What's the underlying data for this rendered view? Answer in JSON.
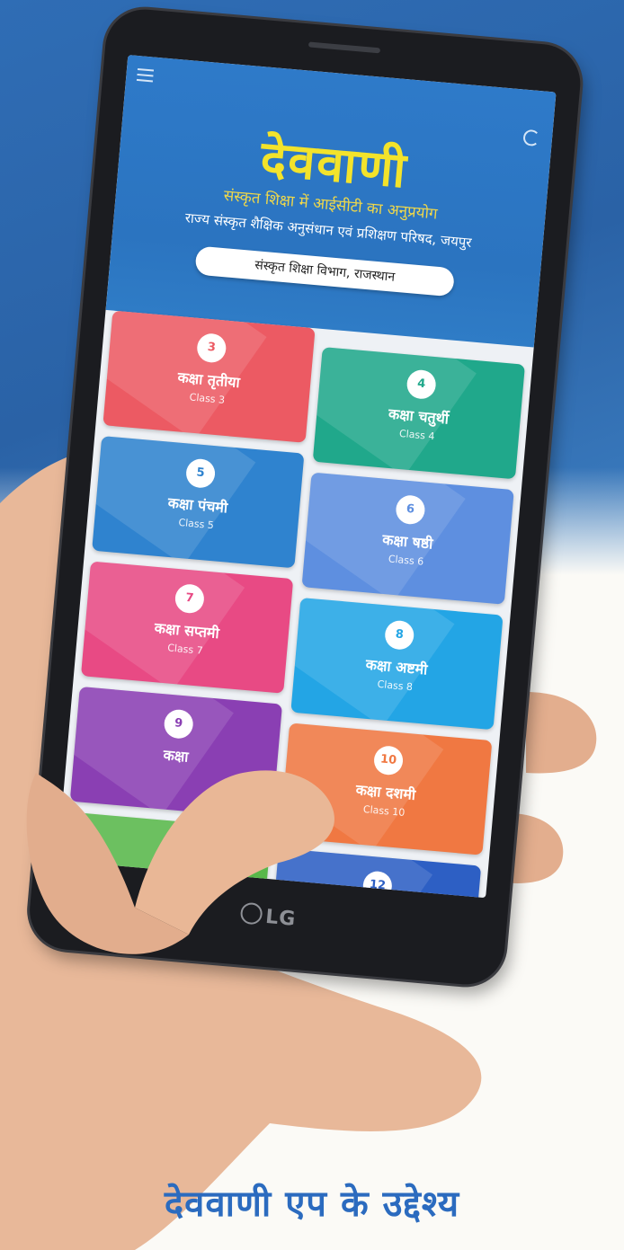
{
  "app": {
    "title": "देववाणी",
    "subtitle": "संस्कृत शिक्षा में आईसीटी का अनुप्रयोग",
    "institute": "राज्य संस्कृत शैक्षिक अनुसंधान एवं प्रशिक्षण परिषद, जयपुर",
    "department": "संस्कृत शिक्षा विभाग, राजस्थान"
  },
  "classes": [
    {
      "number": "3",
      "name_hi": "कक्षा तृतीया",
      "name_en": "Class 3",
      "color": "#ec5a63"
    },
    {
      "number": "4",
      "name_hi": "कक्षा चतुर्थी",
      "name_en": "Class 4",
      "color": "#20a88b"
    },
    {
      "number": "5",
      "name_hi": "कक्षा पंचमी",
      "name_en": "Class 5",
      "color": "#2f83cf"
    },
    {
      "number": "6",
      "name_hi": "कक्षा षष्ठी",
      "name_en": "Class 6",
      "color": "#5e8fe0"
    },
    {
      "number": "7",
      "name_hi": "कक्षा सप्तमी",
      "name_en": "Class 7",
      "color": "#e84a84"
    },
    {
      "number": "8",
      "name_hi": "कक्षा अष्टमी",
      "name_en": "Class 8",
      "color": "#23a5e5"
    },
    {
      "number": "9",
      "name_hi": "कक्षा",
      "name_en": "",
      "color": "#8a3fb3"
    },
    {
      "number": "10",
      "name_hi": "कक्षा दशमी",
      "name_en": "Class 10",
      "color": "#f07842"
    },
    {
      "number": "12",
      "name_hi": "",
      "name_en": "",
      "color": "#2d5fc4"
    }
  ],
  "phone_brand": "LG",
  "caption": "देववाणी एप के उद्देश्य",
  "icons": [
    "menu-icon",
    "refresh-icon",
    "lg-logo-icon"
  ],
  "colors": {
    "background_blue": "#2f6db5",
    "title_yellow": "#f3e32b",
    "caption_blue": "#2b6bbf"
  }
}
